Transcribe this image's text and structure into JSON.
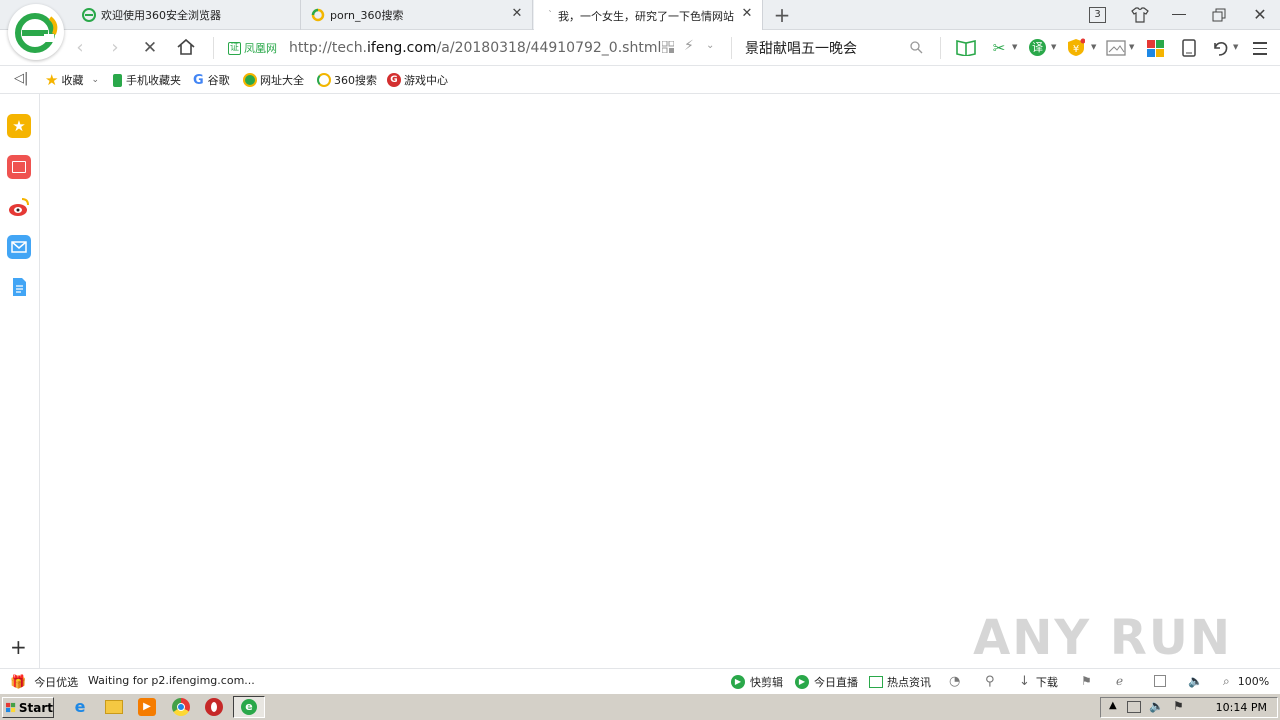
{
  "tabs": [
    {
      "title": "欢迎使用360安全浏览器",
      "active": false
    },
    {
      "title": "porn_360搜索",
      "active": false
    },
    {
      "title": "我，一个女生，研究了一下色情网站",
      "active": true
    }
  ],
  "tab_counter": "3",
  "nav": {
    "cert_label": "凤凰网",
    "url_prefix": "http://tech.",
    "url_domain": "ifeng.com",
    "url_path": "/a/20180318/44910792_0.shtml",
    "search_text": "景甜献唱五一晚会"
  },
  "bookmarks": [
    {
      "label": "收藏"
    },
    {
      "label": "手机收藏夹"
    },
    {
      "label": "谷歌"
    },
    {
      "label": "网址大全"
    },
    {
      "label": "360搜索"
    },
    {
      "label": "游戏中心"
    }
  ],
  "status": {
    "left_label": "今日优选",
    "message": "Waiting for p2.ifengimg.com...",
    "items": [
      "快剪辑",
      "今日直播",
      "热点资讯",
      "下载"
    ],
    "zoom": "100%"
  },
  "taskbar": {
    "start_label": "Start",
    "clock": "10:14 PM"
  },
  "watermark": "ANY RUN",
  "colors": {
    "accent_green": "#2aa84a",
    "tab_bg": "#eceff2"
  }
}
